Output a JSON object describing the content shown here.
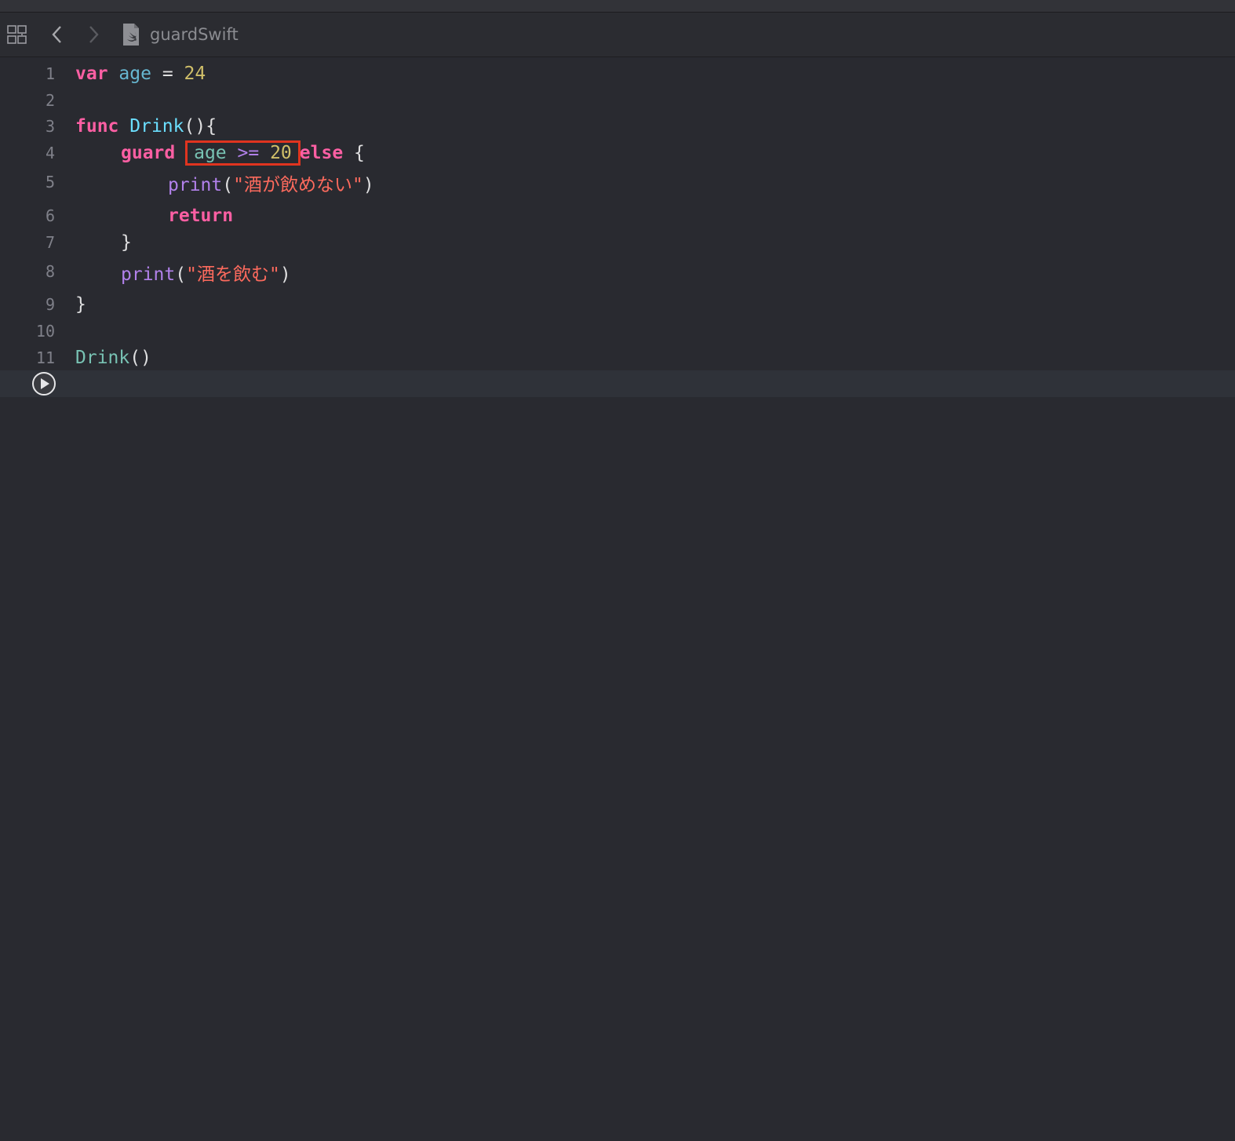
{
  "jumpbar": {
    "file_name": "guardSwift",
    "icons": [
      "related-items-icon",
      "back-chevron-icon",
      "forward-chevron-icon",
      "swift-file-icon"
    ]
  },
  "editor": {
    "line_numbers": [
      "1",
      "2",
      "3",
      "4",
      "5",
      "6",
      "7",
      "8",
      "9",
      "10",
      "11"
    ],
    "lines": {
      "l1": {
        "kw": "var",
        "name": "age",
        "op": "=",
        "value": "24"
      },
      "l3": {
        "kw": "func",
        "name": "Drink",
        "rest": "(){"
      },
      "l4": {
        "kw": "guard",
        "cond_var": "age",
        "cond_op": ">=",
        "cond_val": "20",
        "kw2": "else",
        "brace": "{"
      },
      "l5": {
        "fn": "print",
        "open": "(",
        "str": "\"酒が飲めない\"",
        "close": ")"
      },
      "l6": {
        "kw": "return"
      },
      "l7": {
        "brace": "}"
      },
      "l8": {
        "fn": "print",
        "open": "(",
        "str": "\"酒を飲む\"",
        "close": ")"
      },
      "l9": {
        "brace": "}"
      },
      "l11": {
        "call": "Drink",
        "rest": "()"
      }
    },
    "highlight_color": "#e0341f",
    "run_button_icon": "play-icon"
  }
}
